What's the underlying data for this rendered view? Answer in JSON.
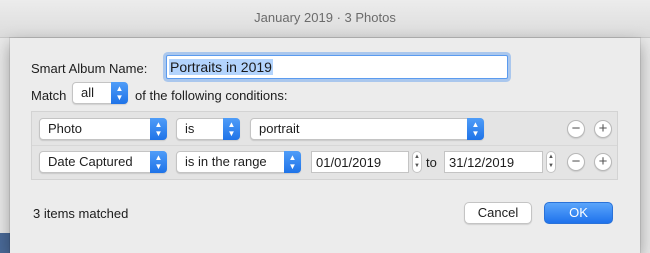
{
  "window": {
    "title": "January 2019 · 3 Photos"
  },
  "dialog": {
    "name_label": "Smart Album Name:",
    "name_value": "Portraits in 2019",
    "match_label": "Match",
    "match_value": "all",
    "following_label": "of the following conditions:",
    "conditions": [
      {
        "field": "Photo",
        "operator": "is",
        "value": "portrait",
        "remove_label": "−",
        "add_label": "+"
      },
      {
        "field": "Date Captured",
        "operator": "is in the range",
        "from": "01/01/2019",
        "to_label": "to",
        "to": "31/12/2019",
        "remove_label": "−",
        "add_label": "+"
      }
    ],
    "matched_text": "3 items matched",
    "cancel_label": "Cancel",
    "ok_label": "OK"
  },
  "icons": {
    "popup_arrows": "chevron-updown-icon",
    "stepper": "stepper-arrows-icon",
    "remove": "minus-circle-icon",
    "add": "plus-circle-icon"
  },
  "colors": {
    "accent": "#1f73e8",
    "selection": "#b3d4fd",
    "focus_ring": "#5b9bef"
  }
}
